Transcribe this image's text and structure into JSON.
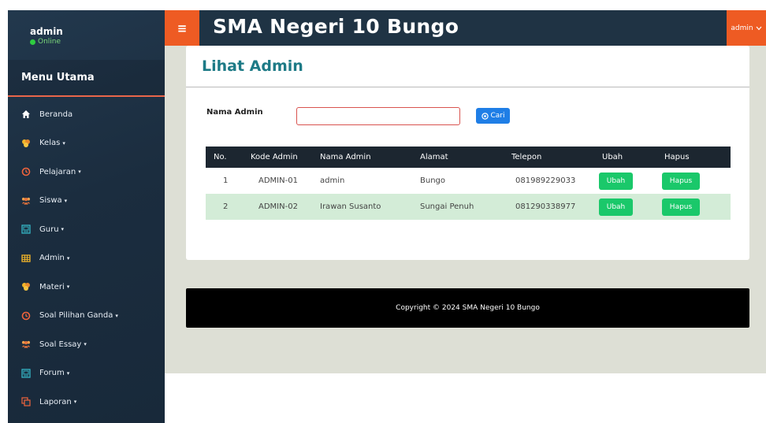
{
  "sidebar": {
    "user_name": "admin",
    "status": "Online",
    "menu_title": "Menu Utama",
    "items": [
      {
        "label": "Beranda",
        "icon": "home-icon",
        "caret": ""
      },
      {
        "label": "Kelas",
        "icon": "cubes-icon",
        "caret": "▾"
      },
      {
        "label": "Pelajaran",
        "icon": "clock-icon",
        "caret": "▾"
      },
      {
        "label": "Siswa",
        "icon": "users-icon",
        "caret": "▾"
      },
      {
        "label": "Guru",
        "icon": "id-card-icon",
        "caret": "▾"
      },
      {
        "label": "Admin",
        "icon": "table-icon",
        "caret": "▾"
      },
      {
        "label": "Materi",
        "icon": "cubes-icon",
        "caret": "▾"
      },
      {
        "label": "Soal Pilihan Ganda",
        "icon": "clock-icon",
        "caret": "▾"
      },
      {
        "label": "Soal Essay",
        "icon": "users-icon",
        "caret": "▾"
      },
      {
        "label": "Forum",
        "icon": "id-card-icon",
        "caret": "▾"
      },
      {
        "label": "Laporan",
        "icon": "copy-icon",
        "caret": "▾"
      }
    ]
  },
  "header": {
    "menu_icon": "≡",
    "title": "SMA Negeri 10 Bungo",
    "user_label": "admin"
  },
  "page": {
    "title": "Lihat Admin",
    "search_label": "Nama Admin",
    "search_value": "",
    "search_button": "Cari"
  },
  "table": {
    "headers": [
      "No.",
      "Kode Admin",
      "Nama Admin",
      "Alamat",
      "Telepon",
      "Ubah",
      "Hapus"
    ],
    "rows": [
      {
        "no": "1",
        "kode": "ADMIN-01",
        "nama": "admin",
        "alamat": "Bungo",
        "telepon": "081989229033",
        "ubah": "Ubah",
        "hapus": "Hapus"
      },
      {
        "no": "2",
        "kode": "ADMIN-02",
        "nama": "Irawan Susanto",
        "alamat": "Sungai Penuh",
        "telepon": "081290338977",
        "ubah": "Ubah",
        "hapus": "Hapus"
      }
    ]
  },
  "footer": {
    "text": "Copyright © 2024 SMA Negeri 10 Bungo"
  },
  "colors": {
    "sidebar": "#1f3344",
    "accent": "#ee5b23",
    "title": "#1d7a86",
    "button_blue": "#1f7ee6",
    "button_green": "#1ac86a",
    "row_highlight": "#d3ecd7"
  }
}
